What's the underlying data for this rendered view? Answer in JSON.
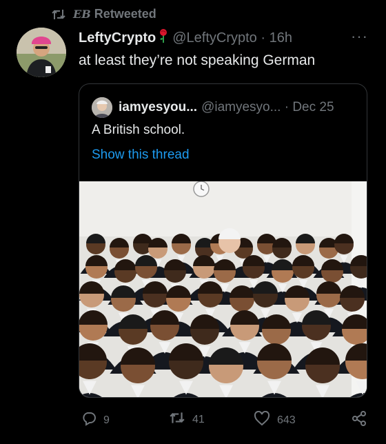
{
  "retweet": {
    "who": "EB",
    "label": "Retweeted"
  },
  "tweet": {
    "display_name": "LeftyCrypto",
    "handle": "@LeftyCrypto",
    "time": "16h",
    "text": "at least they’re not speaking German"
  },
  "quote": {
    "display_name": "iamyesyou...",
    "handle": "@iamyesyo...",
    "date": "Dec 25",
    "text": "A British school.",
    "link": "Show this thread"
  },
  "metrics": {
    "replies": "9",
    "retweets": "41",
    "likes": "643"
  },
  "colors": {
    "background": "#000000",
    "text": "#e7e9ea",
    "muted": "#71767b",
    "link": "#1d9bf0",
    "border": "#333639"
  },
  "icons": [
    "retweet-icon",
    "rose-icon",
    "more-icon",
    "reply-icon",
    "like-icon",
    "share-icon"
  ]
}
